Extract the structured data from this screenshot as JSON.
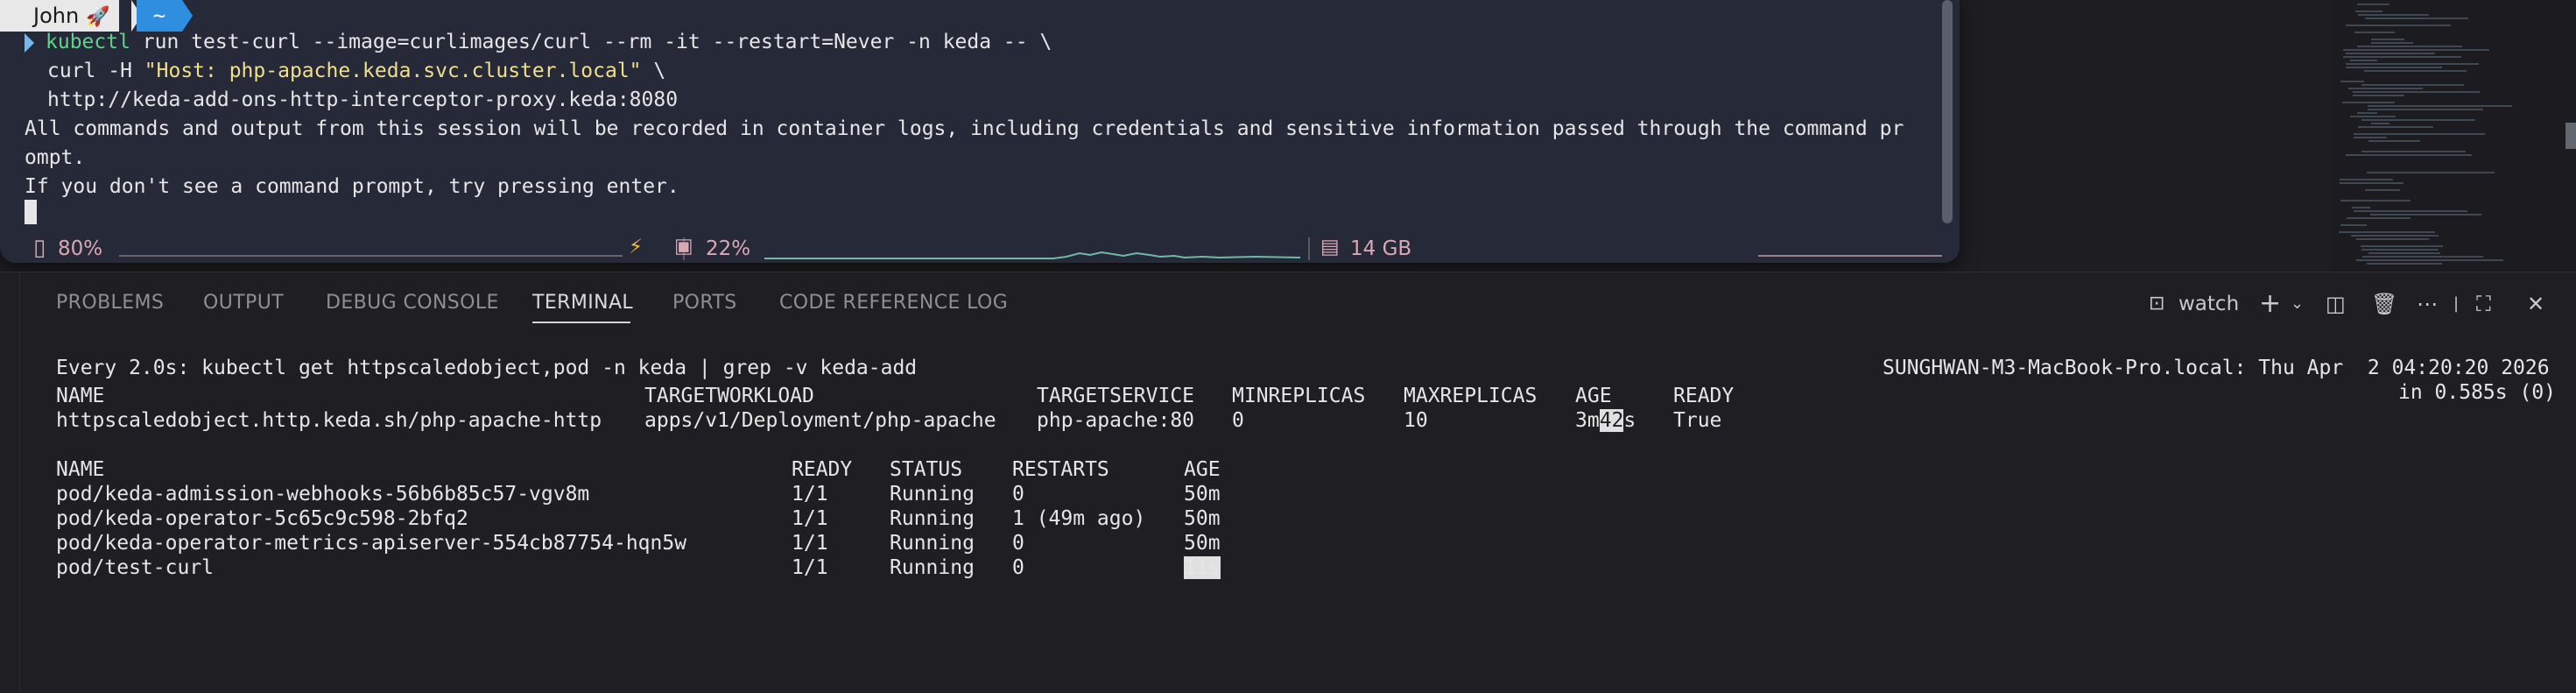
{
  "floating_terminal": {
    "prompt": {
      "user": "John",
      "icon": "rocket-icon",
      "dir": "~"
    },
    "command_lines": [
      {
        "cmd": "kubectl",
        "rest": " run test-curl --image=curlimages/curl --rm -it --restart=Never -n keda -- \\"
      },
      {
        "before": "curl -H ",
        "string": "\"Host: php-apache.keda.svc.cluster.local\"",
        "after": " \\"
      },
      {
        "text": "http://keda-add-ons-http-interceptor-proxy.keda:8080"
      }
    ],
    "output_lines": [
      "All commands and output from this session will be recorded in container logs, including credentials and sensitive information passed through the command pr",
      "ompt.",
      "If you don't see a command prompt, try pressing enter."
    ],
    "status": {
      "battery": "80%",
      "cpu": "22%",
      "memory": "14 GB"
    },
    "colors": {
      "background": "#262938",
      "command": "#62d28b",
      "string": "#f0df8c",
      "status": "#d8a9b4"
    }
  },
  "panel": {
    "tabs": [
      {
        "label": "PROBLEMS",
        "active": false
      },
      {
        "label": "OUTPUT",
        "active": false
      },
      {
        "label": "DEBUG CONSOLE",
        "active": false
      },
      {
        "label": "TERMINAL",
        "active": true
      },
      {
        "label": "PORTS",
        "active": false
      },
      {
        "label": "CODE REFERENCE LOG",
        "active": false
      }
    ],
    "actions": {
      "terminal_name": "watch"
    }
  },
  "watch": {
    "header": "Every 2.0s: kubectl get httpscaledobject,pod -n keda | grep -v keda-add",
    "host_time": "SUNGHWAN-M3-MacBook-Pro.local: Thu Apr  2 04:20:20 2026",
    "duration": "in 0.585s (0)",
    "hso_table": {
      "headers": [
        "NAME",
        "TARGETWORKLOAD",
        "TARGETSERVICE",
        "MINREPLICAS",
        "MAXREPLICAS",
        "AGE",
        "READY"
      ],
      "row": {
        "name": "httpscaledobject.http.keda.sh/php-apache-http",
        "workload": "apps/v1/Deployment/php-apache",
        "service": "php-apache:80",
        "min": "0",
        "max": "10",
        "age_a": "3m",
        "age_b": "42",
        "age_c": "s",
        "ready": "True"
      }
    },
    "pod_table": {
      "headers": [
        "NAME",
        "READY",
        "STATUS",
        "RESTARTS",
        "AGE"
      ],
      "rows": [
        {
          "name": "pod/keda-admission-webhooks-56b6b85c57-vgv8m",
          "ready": "1/1",
          "status": "Running",
          "restarts": "0",
          "age": "50m"
        },
        {
          "name": "pod/keda-operator-5c65c9c598-2bfq2",
          "ready": "1/1",
          "status": "Running",
          "restarts": "1 (49m ago)",
          "age": "50m"
        },
        {
          "name": "pod/keda-operator-metrics-apiserver-554cb87754-hqn5w",
          "ready": "1/1",
          "status": "Running",
          "restarts": "0",
          "age": "50m"
        },
        {
          "name": "pod/test-curl",
          "ready": "1/1",
          "status": "Running",
          "restarts": "0",
          "age": "11s"
        }
      ]
    }
  }
}
